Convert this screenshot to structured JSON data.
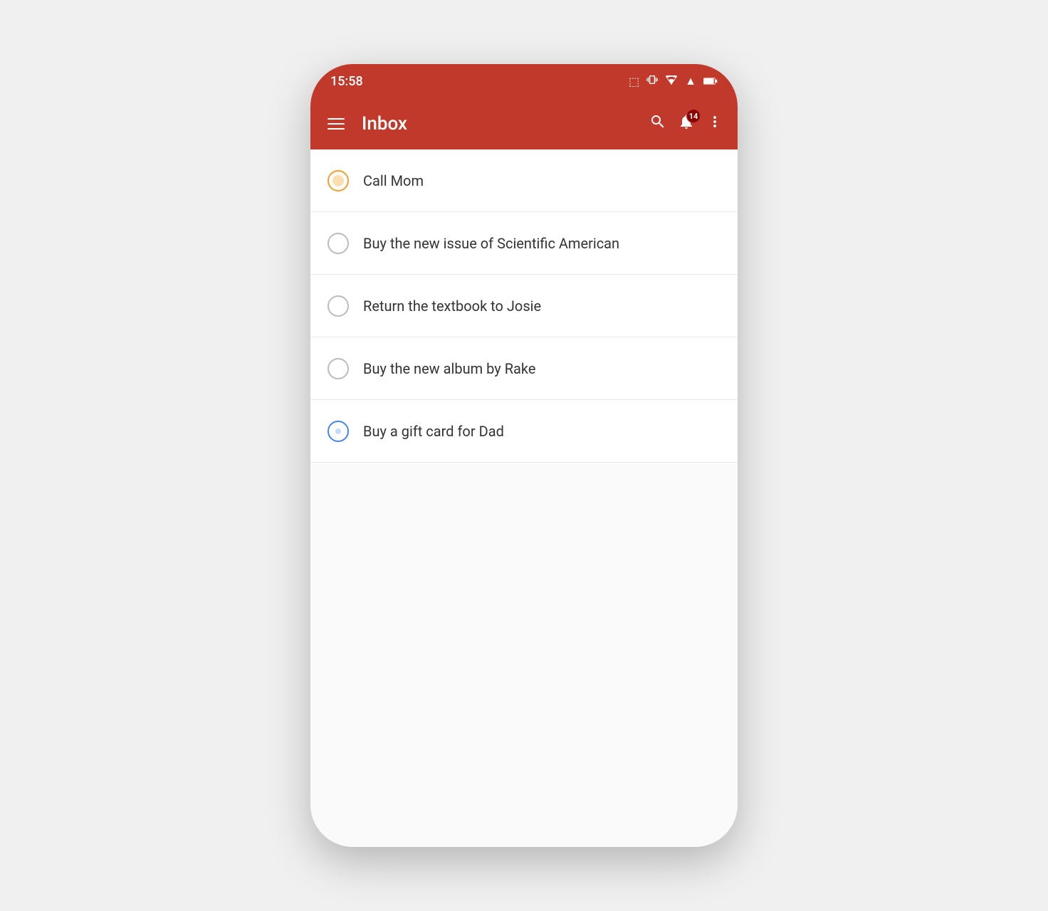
{
  "status_bar": {
    "time": "15:58",
    "notification_badge": "14"
  },
  "app_bar": {
    "title": "Inbox",
    "search_label": "Search",
    "notifications_label": "Notifications",
    "more_label": "More options"
  },
  "tasks": [
    {
      "id": 1,
      "label": "Call Mom",
      "checkbox_state": "orange",
      "checked": false
    },
    {
      "id": 2,
      "label": "Buy the new issue of Scientific American",
      "checkbox_state": "gray",
      "checked": false
    },
    {
      "id": 3,
      "label": "Return the textbook to Josie",
      "checkbox_state": "gray",
      "checked": false
    },
    {
      "id": 4,
      "label": "Buy the new album by Rake",
      "checkbox_state": "gray",
      "checked": false
    },
    {
      "id": 5,
      "label": "Buy a gift card for Dad",
      "checkbox_state": "blue",
      "checked": false
    }
  ]
}
